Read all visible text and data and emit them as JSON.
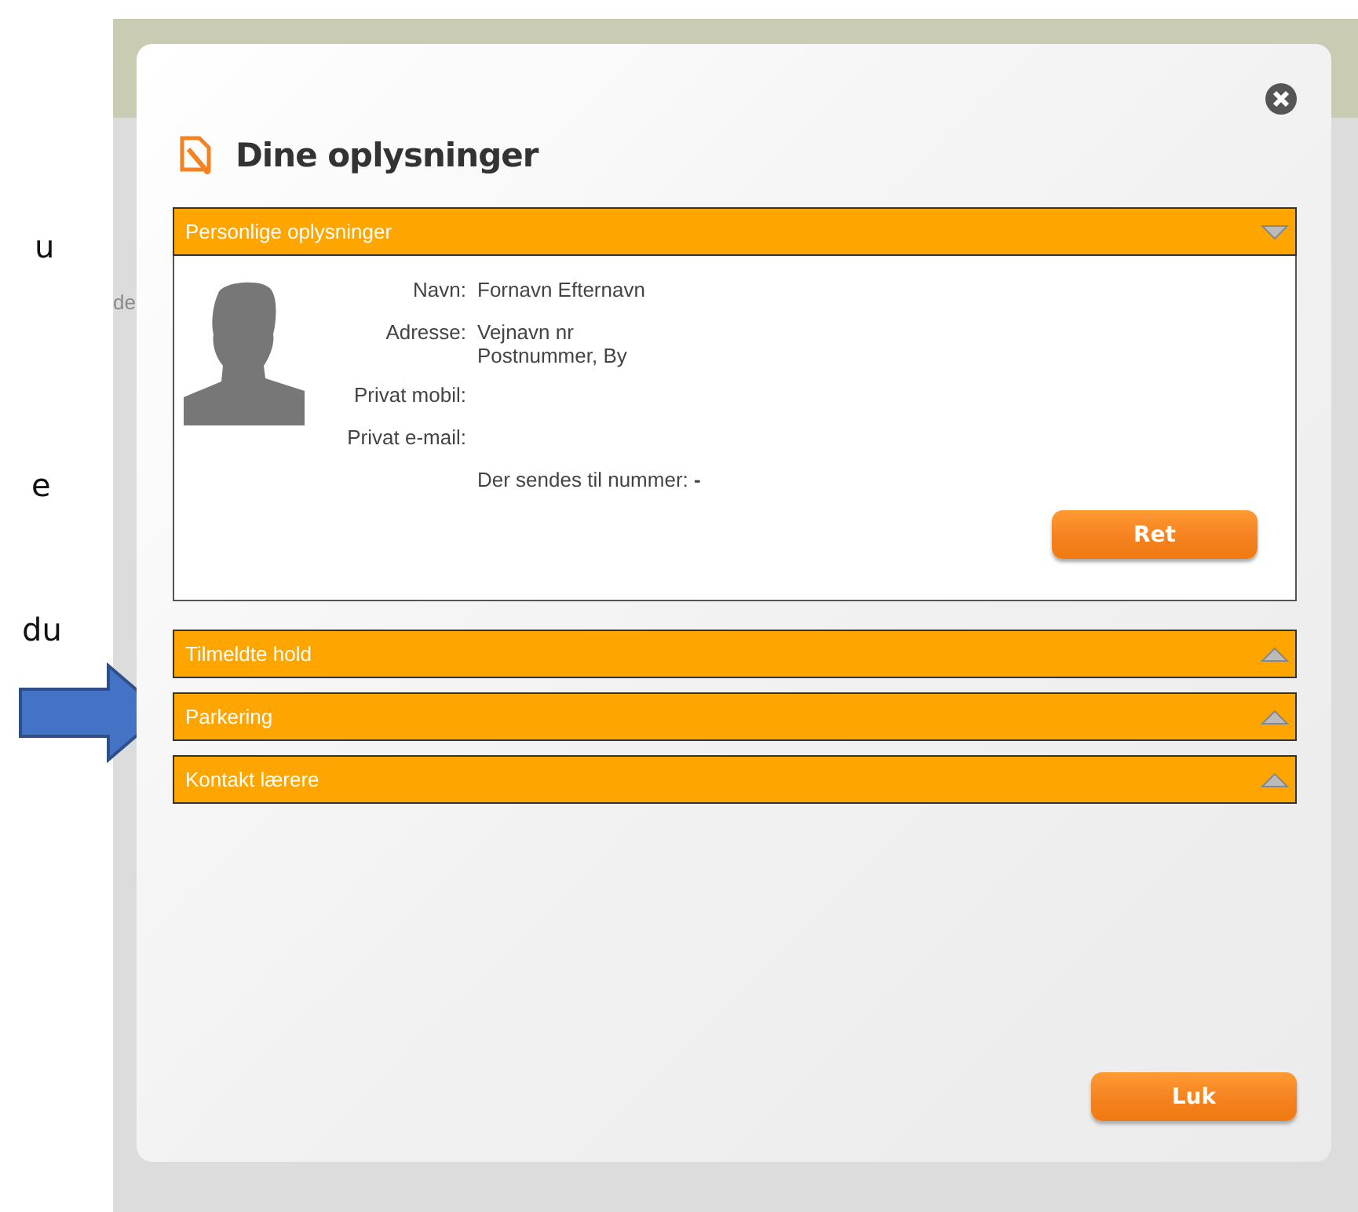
{
  "left_fragments": [
    "u",
    "e",
    "du"
  ],
  "background_fragment": "de",
  "dialog": {
    "title": "Dine oplysninger",
    "sections": [
      {
        "title": "Personlige oplysninger",
        "expanded": true,
        "content": {
          "fields": [
            {
              "label": "Navn:",
              "lines": [
                "Fornavn Efternavn"
              ]
            },
            {
              "label": "Adresse:",
              "lines": [
                "Vejnavn nr",
                "Postnummer, By"
              ]
            },
            {
              "label": "Privat mobil:"
            },
            {
              "label": "Privat e-mail:"
            }
          ],
          "note": "Der sendes til nummer: **-**",
          "edit_button": "Ret"
        }
      },
      {
        "title": "Tilmeldte hold",
        "expanded": false
      },
      {
        "title": "Parkering",
        "expanded": false
      },
      {
        "title": "Kontakt lærere",
        "expanded": false
      }
    ],
    "close_button": "Luk"
  }
}
